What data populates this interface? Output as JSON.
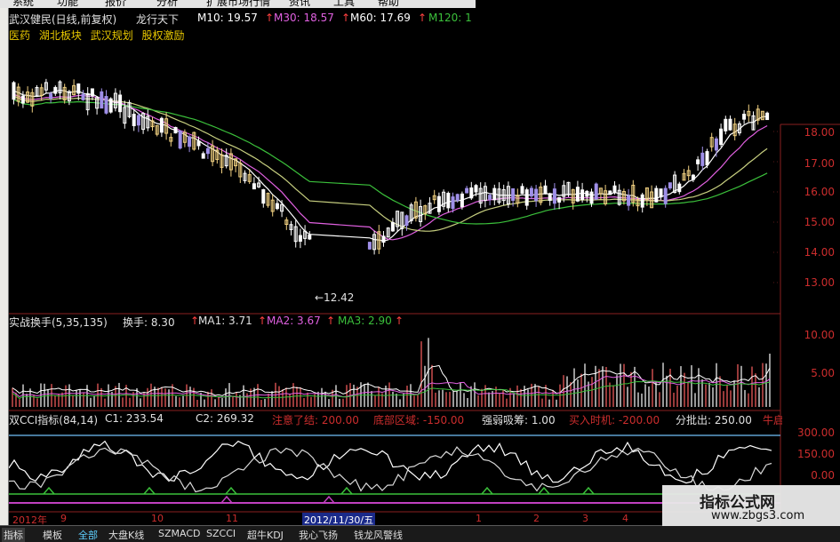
{
  "menu": [
    "系统",
    "功能",
    "报价",
    "分析",
    "扩展市场行情",
    "资讯",
    "工具",
    "帮助"
  ],
  "header": {
    "stock": "武汉健民(日线,前复权)",
    "tag": "龙行天下",
    "ma10": "M10: 19.57",
    "ma30": "M30: 18.57",
    "ma60": "M60: 17.69",
    "ma120": "M120: 1",
    "arrow": "↑"
  },
  "concepts": [
    "医药",
    "湖北板块",
    "武汉规划",
    "股权激励"
  ],
  "price_chart": {
    "low_label": "←12.42",
    "y_ticks": [
      "18.00",
      "17.00",
      "16.00",
      "15.00",
      "14.00",
      "13.00"
    ],
    "colors": {
      "ma10": "#ffffff",
      "ma30": "#e8c800",
      "ma60": "#cc44cc",
      "ma120": "#3bc03b"
    }
  },
  "turnover": {
    "title": "实战换手(5,35,135)",
    "huan": "换手: 8.30",
    "ma1": "MA1: 3.71",
    "ma2": "MA2: 3.67",
    "ma3": "MA3: 2.90",
    "y_ticks": [
      "10.00",
      "5.00"
    ]
  },
  "cci": {
    "title": "双CCI指标(84,14)",
    "c1": "C1: 233.54",
    "c2": "C2: 269.32",
    "note1": "注意了结: 200.00",
    "note2": "底部区域: -150.00",
    "note3": "强弱吸筹: 1.00",
    "note4": "买入时机: -200.00",
    "note5": "分批出: 250.00",
    "note6": "牛启动",
    "y_ticks": [
      "300.00",
      "150.00",
      "0.00"
    ]
  },
  "date_axis": [
    "2012年",
    "9",
    "10",
    "11",
    "2012/11/30/五",
    "1",
    "2",
    "3",
    "4"
  ],
  "tabs": [
    "指标",
    "模板",
    "全部",
    "大盘K线",
    "SZMACD",
    "SZCCI",
    "超牛KDJ",
    "我心飞扬",
    "钱龙风警线"
  ],
  "watermark": {
    "title": "指标公式网",
    "url": "www.zbgs3.com"
  }
}
